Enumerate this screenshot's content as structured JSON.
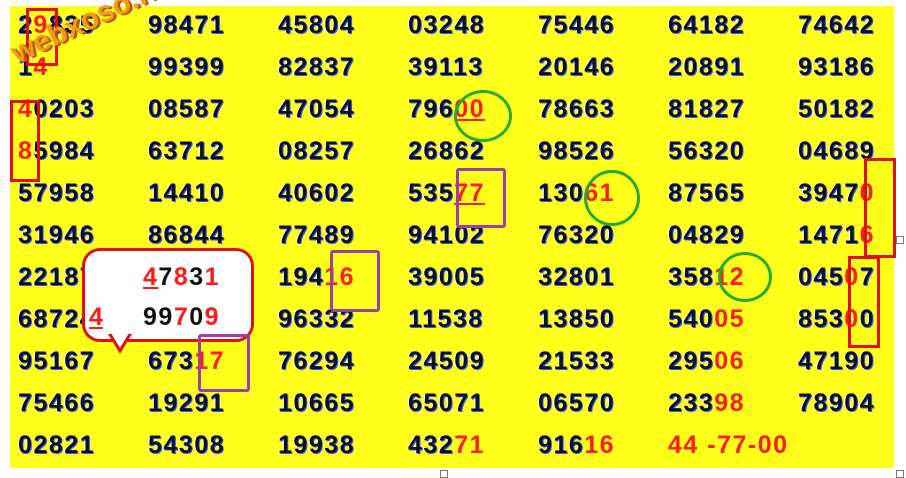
{
  "watermark": "webxoso.net",
  "rows": [
    [
      "29835",
      "98471",
      "45804",
      "03248",
      "75446",
      "64182",
      "74642"
    ],
    [
      "14",
      "99399",
      "82837",
      "39113",
      "20146",
      "20891",
      "93186"
    ],
    [
      "40203",
      "08587",
      "47054",
      "79600",
      "78663",
      "81827",
      "50182"
    ],
    [
      "85984",
      "63712",
      "08257",
      "26862",
      "98526",
      "56320",
      "04689"
    ],
    [
      "57958",
      "14410",
      "40602",
      "53577",
      "13061",
      "87565",
      "39470"
    ],
    [
      "31946",
      "86844",
      "77489",
      "94102",
      "76320",
      "04829",
      "14716"
    ],
    [
      "22187",
      "",
      "19416",
      "39005",
      "32801",
      "35812",
      "04507"
    ],
    [
      "68724",
      "",
      "96332",
      "11538",
      "13850",
      "54005",
      "85300"
    ],
    [
      "95167",
      "67317",
      "76294",
      "24509",
      "21533",
      "29506",
      "47190"
    ],
    [
      "75466",
      "19291",
      "10665",
      "65071",
      "06570",
      "23398",
      "78904"
    ],
    [
      "02821",
      "54308",
      "19938",
      "43271",
      "91616",
      "44 -77-00",
      ""
    ]
  ],
  "callout": {
    "line1": "47831",
    "line2": "99709",
    "digit": "4"
  },
  "colors": {
    "background": "#ffff1a",
    "highlight_red": "#e01010",
    "circle_green": "#22aa33",
    "box_purple": "#9a40a8"
  }
}
